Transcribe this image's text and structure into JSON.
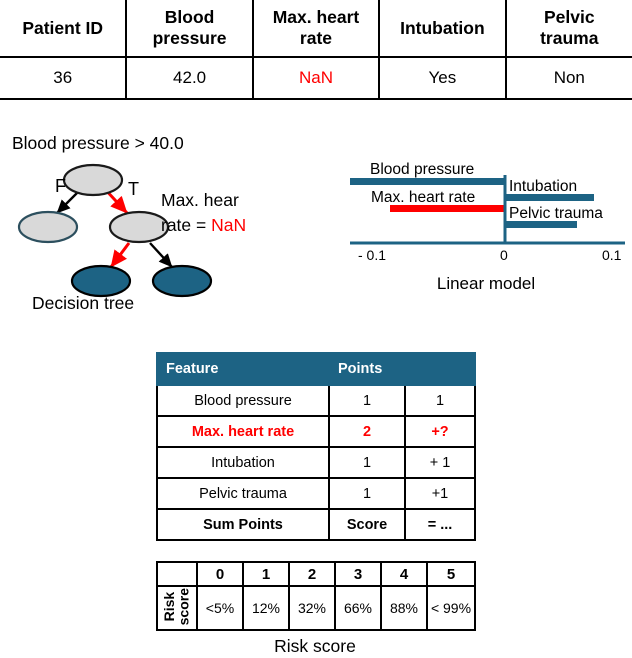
{
  "patient_table": {
    "columns": [
      "Patient ID",
      "Blood\npressure",
      "Max. heart\nrate",
      "Intubation",
      "Pelvic\ntrauma"
    ],
    "col_0": "Patient ID",
    "col_1_line1": "Blood",
    "col_1_line2": "pressure",
    "col_2_line1": "Max. heart",
    "col_2_line2": "rate",
    "col_3": "Intubation",
    "col_4_line1": "Pelvic",
    "col_4_line2": "trauma",
    "row": {
      "patient_id": "36",
      "blood_pressure": "42.0",
      "max_heart_rate": "NaN",
      "intubation": "Yes",
      "pelvic_trauma": "Non"
    }
  },
  "decision_tree": {
    "title": "Blood pressure > 40.0",
    "caption": "Decision tree",
    "edge_false_label": "F",
    "edge_true_label": "T",
    "side_label_line1": "Max. hear",
    "side_label_line2_prefix": "rate  = ",
    "side_label_value": "NaN",
    "node_fill_internal": "#d9d9d9",
    "node_fill_leaf": "#1d6384",
    "edge_highlight_color": "#ff0000",
    "edge_color": "#000000"
  },
  "chart_data": {
    "type": "bar",
    "orientation": "horizontal",
    "title": "",
    "xlabel": "Linear model",
    "ylabel": "",
    "xlim": [
      -0.1,
      0.1
    ],
    "xticks": [
      -0.1,
      0,
      0.1
    ],
    "xticklabels": [
      "- 0.1",
      "0",
      "0.1"
    ],
    "grid": false,
    "legend": false,
    "categories": [
      "Blood pressure",
      "Max. heart rate",
      "Intubation",
      "Pelvic trauma"
    ],
    "values": [
      -0.105,
      -0.077,
      0.077,
      0.062
    ],
    "bar_colors": [
      "#1d6384",
      "#ff0000",
      "#1d6384",
      "#1d6384"
    ],
    "annotations": [
      {
        "label": "Blood pressure",
        "side": "above-left"
      },
      {
        "label": "Max. heart rate",
        "side": "above-left"
      },
      {
        "label": "Intubation",
        "side": "above-right"
      },
      {
        "label": "Pelvic trauma",
        "side": "above-right"
      }
    ],
    "caption": "Linear model"
  },
  "points_table": {
    "headers": [
      "Feature",
      "Points",
      ""
    ],
    "header_feature": "Feature",
    "header_points": "Points",
    "header_blank": "",
    "rows": [
      {
        "feature": "Blood pressure",
        "points": "1",
        "running": "1"
      },
      {
        "feature": "Max. heart rate",
        "points": "2",
        "running": "+?"
      },
      {
        "feature": "Intubation",
        "points": "1",
        "running": "+ 1"
      },
      {
        "feature": "Pelvic trauma",
        "points": "1",
        "running": "+1"
      }
    ],
    "sum_row": {
      "feature": "Sum Points",
      "points": "Score",
      "running": "= ..."
    },
    "header_bg": "#1d6384",
    "highlight_color": "#ff0000"
  },
  "risk_table": {
    "row_label": "Risk\nscore",
    "score_labels": [
      "0",
      "1",
      "2",
      "3",
      "4",
      "5"
    ],
    "risk_values": [
      "<5%",
      "12%",
      "32%",
      "66%",
      "88%",
      "< 99%"
    ],
    "caption": "Risk score"
  }
}
